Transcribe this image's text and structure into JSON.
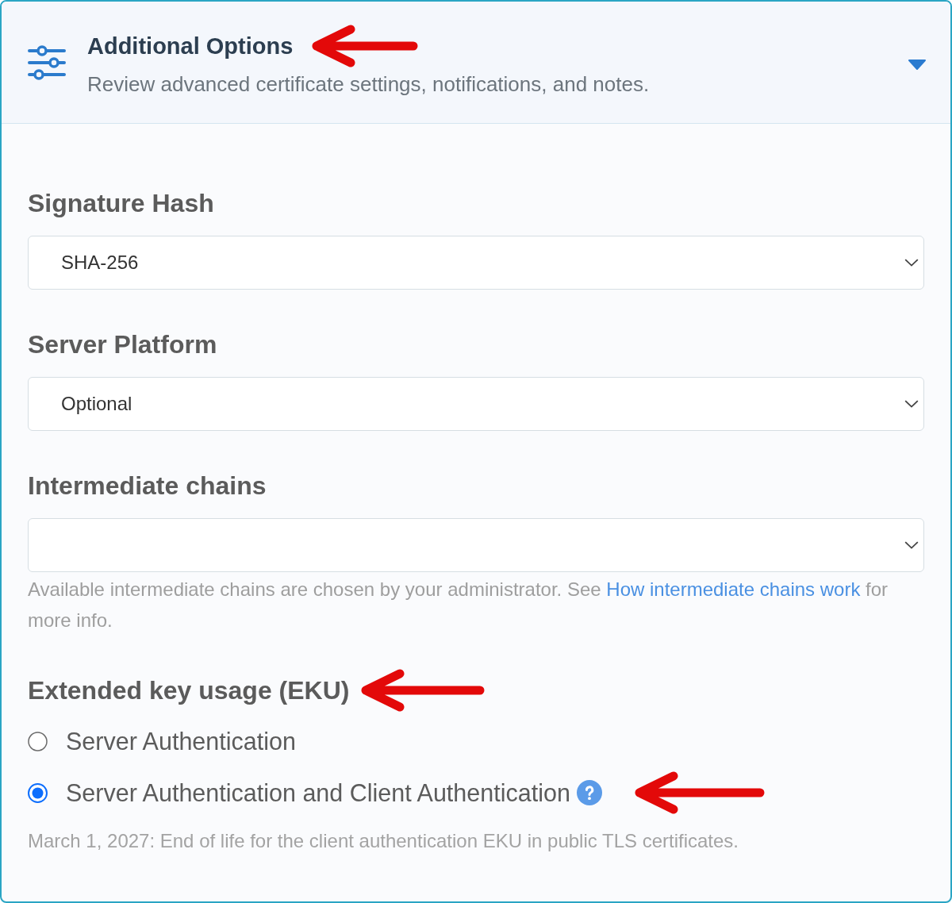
{
  "panel": {
    "title": "Additional Options",
    "title_arrow": true,
    "subtitle": "Review advanced certificate settings, notifications, and notes.",
    "expanded": true
  },
  "fields": [
    {
      "kind": "select",
      "label": "Signature Hash",
      "arrow": false,
      "value": "SHA-256"
    },
    {
      "kind": "select",
      "label": "Server Platform",
      "arrow": false,
      "value": "Optional"
    },
    {
      "kind": "select",
      "label": "Intermediate chains",
      "arrow": false,
      "help": {
        "before": "Available intermediate chains are chosen by your administrator. See",
        "link": "How intermediate chains work",
        "after": "for more info."
      }
    },
    {
      "kind": "radio",
      "label": "Extended key usage (EKU)",
      "arrow": true,
      "options": [
        {
          "label": "Server Authentication",
          "selected": false,
          "help_icon": false,
          "arrow": false
        },
        {
          "label": "Server Authentication and Client Authentication",
          "selected": true,
          "help_icon": true,
          "arrow": true
        }
      ],
      "note": "March 1, 2027: End of life for the client authentication EKU in public TLS certificates."
    }
  ]
}
